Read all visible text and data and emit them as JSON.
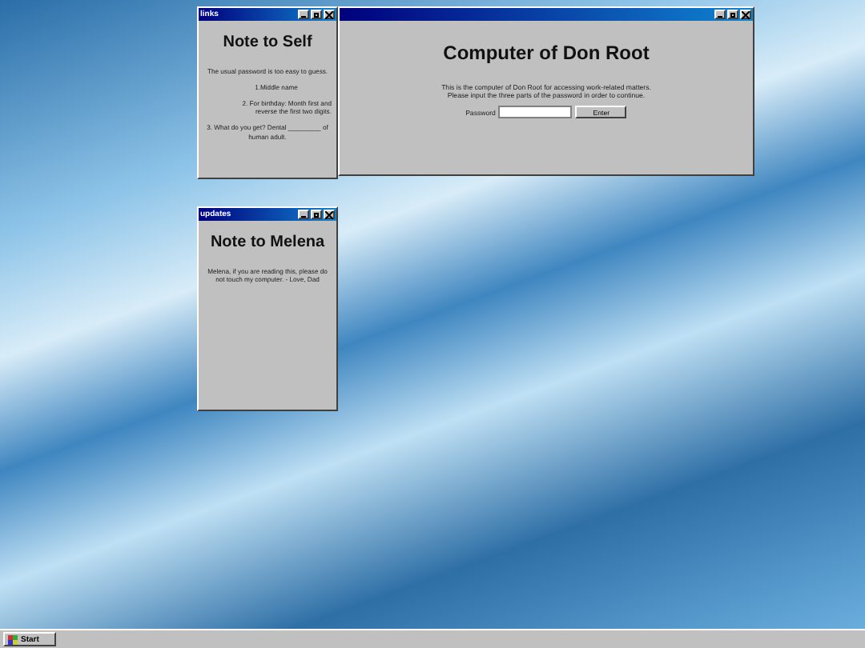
{
  "windows": [
    {
      "kind": "note",
      "title": "links",
      "heading": "Note to Self",
      "paragraphs": [
        "The usual password is too easy to guess.",
        "1.Middle name",
        "2. For birthday: Month first and reverse the first two digits.",
        "3. What do you get? Dental _________ of human adult."
      ]
    },
    {
      "kind": "login",
      "heading": "Computer of Don Root",
      "paragraphs": [
        "This is the computer of Don Root for accessing work-related matters.",
        "Please input the three parts of the password in order to continue."
      ],
      "field_label": "Password",
      "button": "Enter"
    },
    {
      "kind": "note",
      "title": "updates",
      "heading": "Note to Melena",
      "paragraphs": [
        "Melena, if you are reading this, please do not touch my computer. - Love, Dad"
      ]
    }
  ],
  "taskbar": {
    "start": "Start"
  }
}
